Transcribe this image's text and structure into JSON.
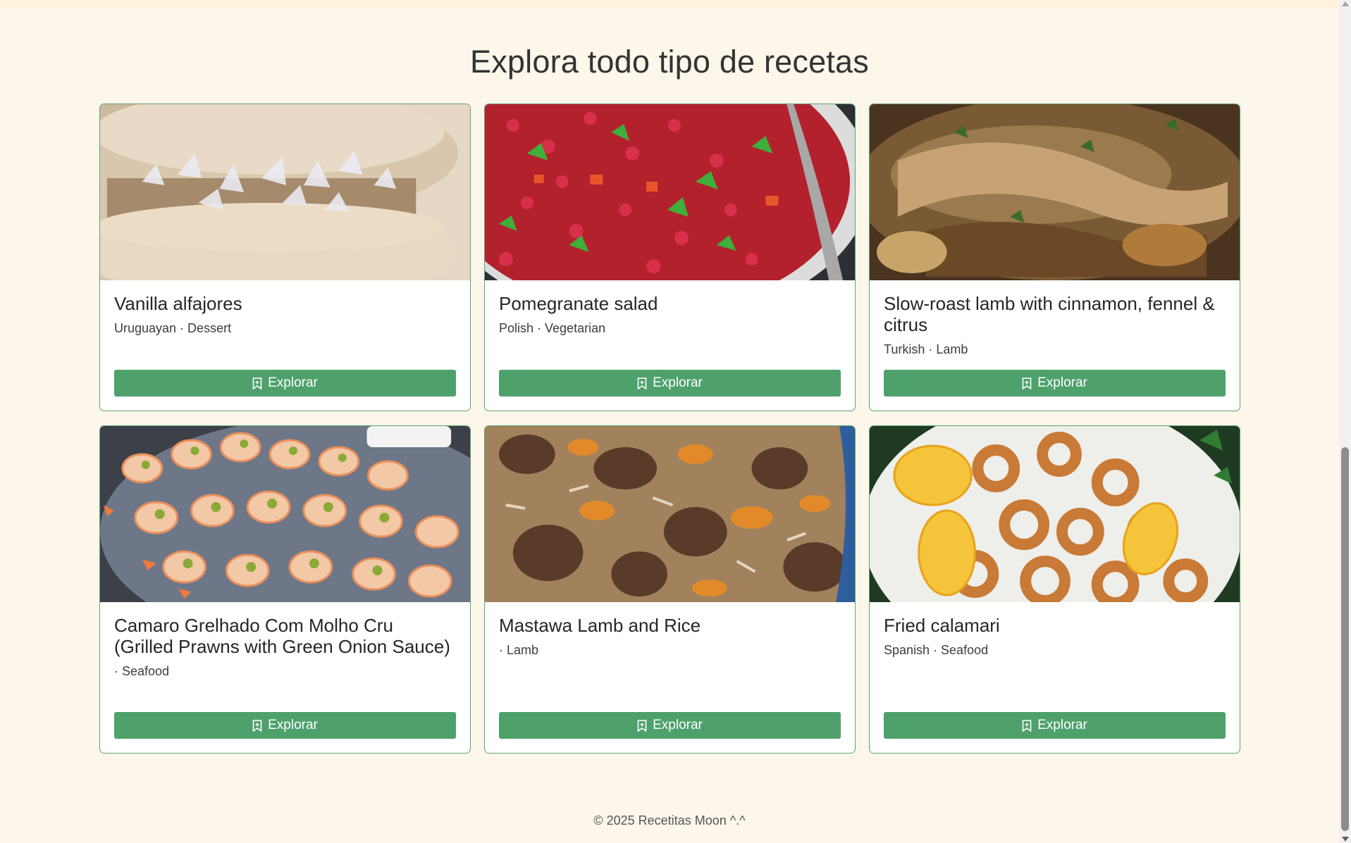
{
  "section_title": "Explora todo tipo de recetas",
  "recipes": [
    {
      "title": "Vanilla alfajores",
      "meta": "Uruguayan · Dessert",
      "image": "vanilla-alfajores-photo",
      "button": "Explorar"
    },
    {
      "title": "Pomegranate salad",
      "meta": "Polish · Vegetarian",
      "image": "pomegranate-salad-photo",
      "button": "Explorar"
    },
    {
      "title": "Slow-roast lamb with cinnamon, fennel & citrus",
      "meta": "Turkish · Lamb",
      "image": "slow-roast-lamb-photo",
      "button": "Explorar"
    },
    {
      "title": "Camaro Grelhado Com Molho Cru (Grilled Prawns with Green Onion Sauce)",
      "meta": " · Seafood",
      "image": "grilled-prawns-photo",
      "button": "Explorar"
    },
    {
      "title": "Mastawa Lamb and Rice",
      "meta": " · Lamb",
      "image": "mastawa-lamb-rice-photo",
      "button": "Explorar"
    },
    {
      "title": "Fried calamari",
      "meta": "Spanish · Seafood",
      "image": "fried-calamari-photo",
      "button": "Explorar"
    }
  ],
  "icons": {
    "button_icon": "bookmark-icon"
  },
  "footer": {
    "text": "© 2025 Recetitas Moon ^.^"
  },
  "colors": {
    "background": "#fdf6ea",
    "accent": "#4ea16b",
    "card_border": "#5da370"
  }
}
